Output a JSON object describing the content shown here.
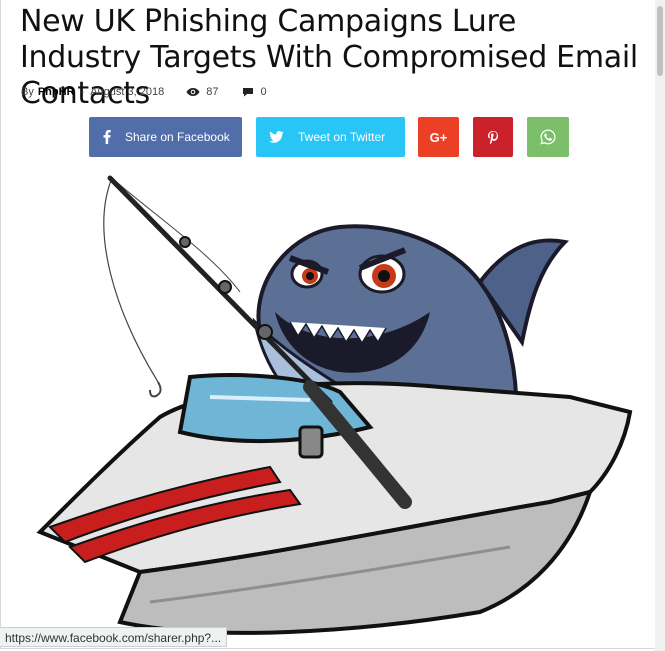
{
  "article": {
    "title": "New UK Phishing Campaigns Lure Industry Targets With Compromised Email Contacts",
    "meta": {
      "by_label": "By",
      "author": "PhpHR",
      "separator": "-",
      "date": "August 3, 2018",
      "views": "87",
      "comments": "0"
    }
  },
  "share": {
    "facebook_label": "Share on Facebook",
    "twitter_label": "Tweet on Twitter",
    "googleplus_label": "G+",
    "pinterest_icon": "pinterest-icon",
    "whatsapp_icon": "whatsapp-icon",
    "colors": {
      "facebook": "#516eab",
      "twitter": "#29c5f6",
      "googleplus": "#eb4026",
      "pinterest": "#ca212a",
      "whatsapp": "#7bbf6a"
    }
  },
  "hero": {
    "icon": "shark-fishing-boat-illustration"
  },
  "status_bar": {
    "url": "https://www.facebook.com/sharer.php?..."
  }
}
